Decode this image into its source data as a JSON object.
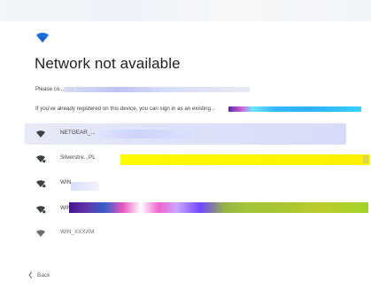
{
  "title": "Network not available",
  "intro_text": "Please co... sign in ...",
  "existing_text": "If you've already registered on this device, you can sign in as an existing...",
  "networks": [
    {
      "name": "NETGEAR_..."
    },
    {
      "name": "Silverstre...PL"
    },
    {
      "name": "WIN_..."
    },
    {
      "name": "WIN_..."
    },
    {
      "name": "WIN_XXXXM"
    }
  ],
  "back_label": "Back",
  "icons": {
    "brand": "wifi-icon",
    "network": "wifi-icon",
    "back": "chevron-left-icon"
  },
  "colors": {
    "accent_blue": "#1a73e8",
    "text": "#202124",
    "secondary_text": "#5f6368"
  }
}
